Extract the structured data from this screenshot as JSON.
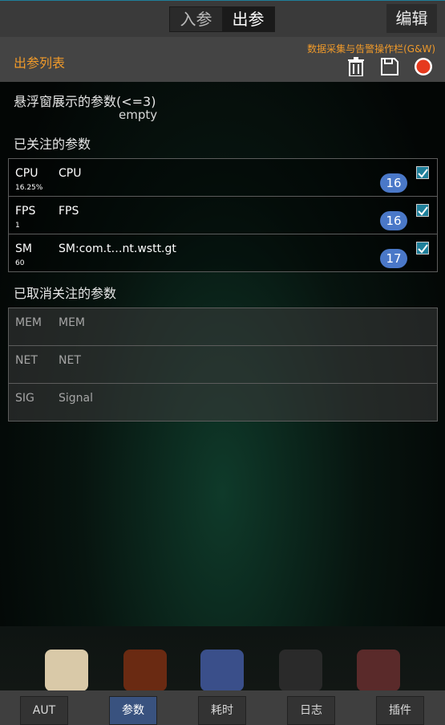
{
  "top": {
    "seg_in": "入参",
    "seg_out": "出参",
    "edit": "编辑"
  },
  "header": {
    "title": "出参列表",
    "ops_label": "数据采集与告警操作栏(G&W)"
  },
  "floating": {
    "label": "悬浮窗展示的参数(<=3)",
    "empty": "empty"
  },
  "followed": {
    "label": "已关注的参数",
    "rows": [
      {
        "key": "CPU",
        "value": "16.25%",
        "name": "CPU",
        "badge": "16"
      },
      {
        "key": "FPS",
        "value": "1",
        "name": "FPS",
        "badge": "16"
      },
      {
        "key": "SM",
        "value": "60",
        "name": "SM:com.t…nt.wstt.gt",
        "badge": "17"
      }
    ]
  },
  "unfollowed": {
    "label": "已取消关注的参数",
    "rows": [
      {
        "key": "MEM",
        "name": "MEM"
      },
      {
        "key": "NET",
        "name": "NET"
      },
      {
        "key": "SIG",
        "name": "Signal"
      }
    ]
  },
  "tabs": [
    "AUT",
    "参数",
    "耗时",
    "日志",
    "插件"
  ],
  "colors": {
    "accent_orange": "#f09a2a",
    "badge_blue": "#4a78c8",
    "active_tab": "#39527f",
    "record_red": "#e63a1e"
  },
  "icons": [
    "trash-icon",
    "save-icon",
    "record-icon",
    "checkbox-checked-icon"
  ]
}
